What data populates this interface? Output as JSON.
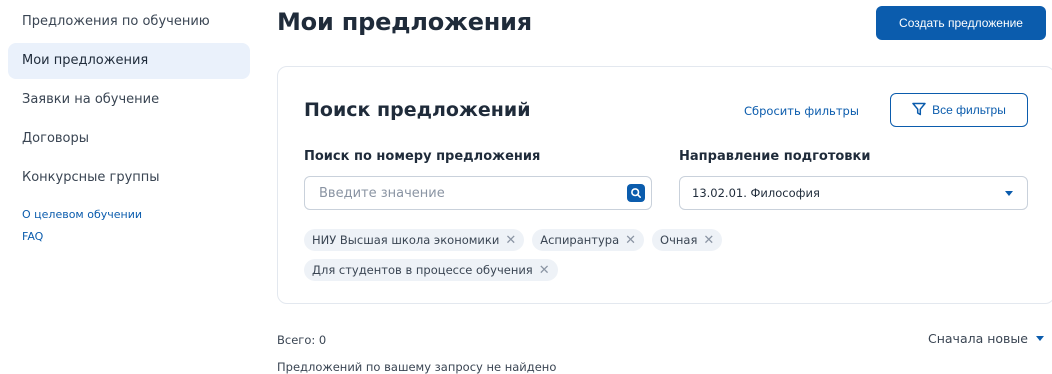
{
  "sidebar": {
    "items": [
      {
        "label": "Предложения по обучению"
      },
      {
        "label": "Мои предложения",
        "active": true
      },
      {
        "label": "Заявки на обучение"
      },
      {
        "label": "Договоры"
      },
      {
        "label": "Конкурсные группы"
      }
    ],
    "links": [
      {
        "label": "О целевом обучении"
      },
      {
        "label": "FAQ"
      }
    ]
  },
  "header": {
    "title": "Мои предложения",
    "create_button": "Создать предложение"
  },
  "search_card": {
    "title": "Поиск предложений",
    "reset_link": "Сбросить фильтры",
    "all_filters_button": "Все фильтры",
    "search_field": {
      "label": "Поиск по номеру предложения",
      "placeholder": "Введите значение",
      "value": ""
    },
    "direction_field": {
      "label": "Направление подготовки",
      "value": "13.02.01. Философия"
    },
    "chips": [
      {
        "label": "НИУ Высшая школа экономики"
      },
      {
        "label": "Аспирантура"
      },
      {
        "label": "Очная"
      },
      {
        "label": "Для студентов в процессе обучения"
      }
    ]
  },
  "results": {
    "total_label": "Всего: 0",
    "sort_label": "Сначала новые",
    "empty_message": "Предложений по вашему запросу не найдено"
  },
  "colors": {
    "accent": "#0b5cad",
    "active_nav_bg": "#eaf1fb",
    "chip_bg": "#eef2f7"
  },
  "icons": {
    "search": "search-icon",
    "filter": "filter-icon",
    "chip_close": "close-icon",
    "dropdown": "chevron-down-icon"
  }
}
